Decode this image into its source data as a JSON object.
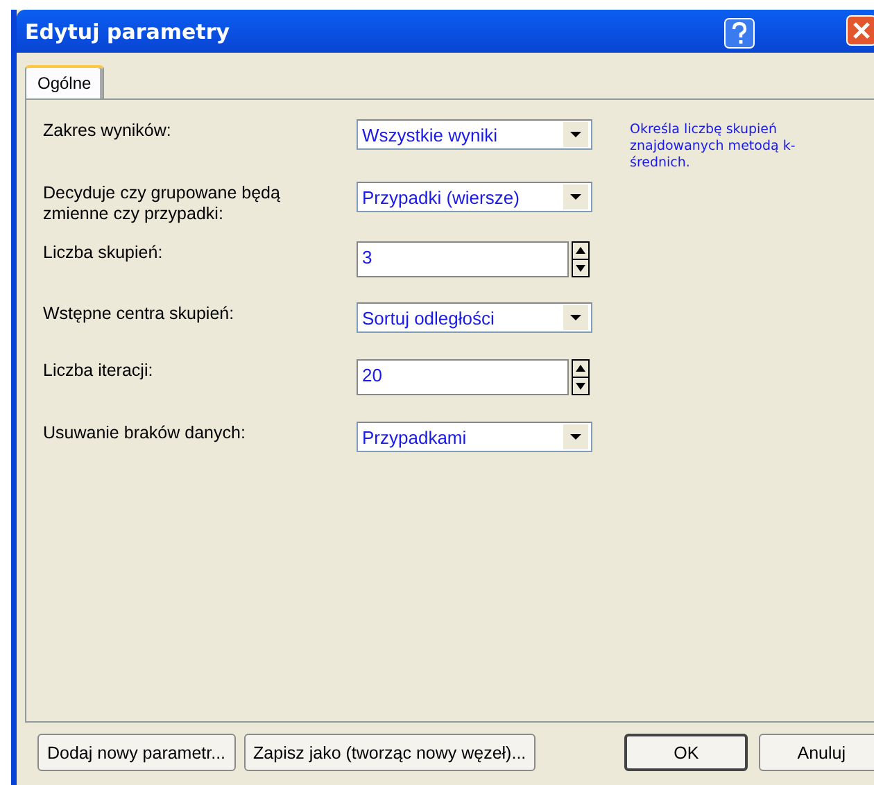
{
  "window": {
    "title": "Edytuj parametry"
  },
  "tabs": [
    {
      "label": "Ogólne",
      "selected": true
    }
  ],
  "fields": [
    {
      "label": "Zakres wyników:",
      "kind": "dropdown",
      "value": "Wszystkie wyniki"
    },
    {
      "label": "Decyduje czy grupowane będą zmienne czy przypadki:",
      "kind": "dropdown",
      "value": "Przypadki (wiersze)"
    },
    {
      "label": "Liczba skupień:",
      "kind": "spinner",
      "value": "3"
    },
    {
      "label": "Wstępne centra skupień:",
      "kind": "dropdown",
      "value": "Sortuj odległości"
    },
    {
      "label": "Liczba iteracji:",
      "kind": "spinner",
      "value": "20"
    },
    {
      "label": "Usuwanie braków danych:",
      "kind": "dropdown",
      "value": "Przypadkami"
    }
  ],
  "help_text": "Określa liczbę skupień znajdowanych metodą k-średnich.",
  "buttons": [
    {
      "label": "Dodaj nowy parametr...",
      "kind": "left"
    },
    {
      "label": "Zapisz jako (tworząc nowy węzeł)...",
      "kind": "left"
    },
    {
      "label": "OK",
      "kind": "default"
    },
    {
      "label": "Anuluj",
      "kind": "right"
    }
  ]
}
